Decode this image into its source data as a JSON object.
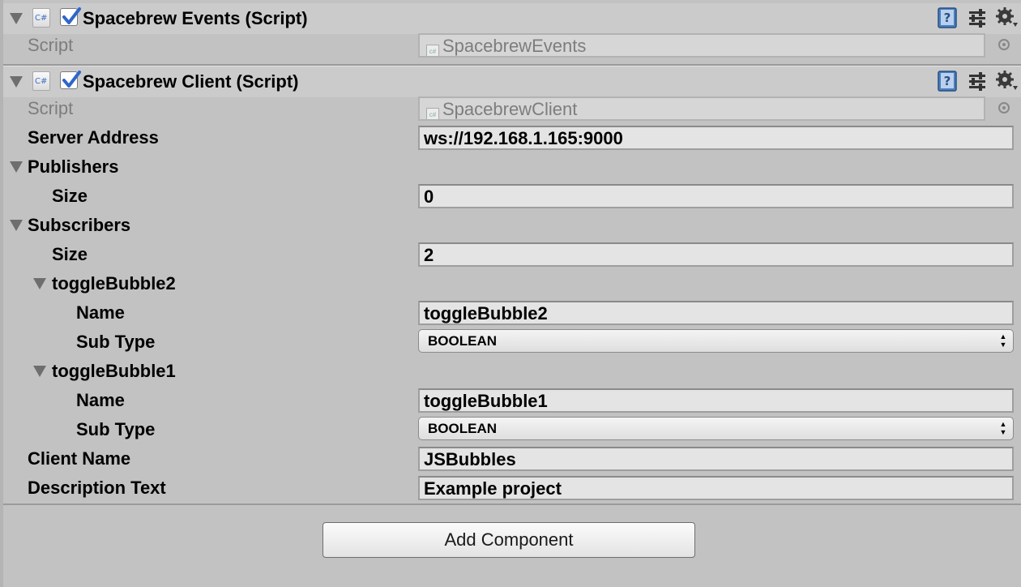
{
  "components": [
    {
      "title": "Spacebrew Events (Script)",
      "enabled": true,
      "icon": "csharp-script-icon",
      "script_label": "Script",
      "script_value": "SpacebrewEvents"
    },
    {
      "title": "Spacebrew Client (Script)",
      "enabled": true,
      "icon": "csharp-script-icon",
      "script_label": "Script",
      "script_value": "SpacebrewClient",
      "server_address": {
        "label": "Server Address",
        "value": "ws://192.168.1.165:9000"
      },
      "publishers": {
        "label": "Publishers",
        "size_label": "Size",
        "size": "0"
      },
      "subscribers": {
        "label": "Subscribers",
        "size_label": "Size",
        "size": "2",
        "items": [
          {
            "header": "toggleBubble2",
            "name_label": "Name",
            "name": "toggleBubble2",
            "type_label": "Sub Type",
            "type": "BOOLEAN"
          },
          {
            "header": "toggleBubble1",
            "name_label": "Name",
            "name": "toggleBubble1",
            "type_label": "Sub Type",
            "type": "BOOLEAN"
          }
        ]
      },
      "client_name": {
        "label": "Client Name",
        "value": "JSBubbles"
      },
      "description": {
        "label": "Description Text",
        "value": "Example project"
      }
    }
  ],
  "add_component_label": "Add Component",
  "mini_icon_text": "c#",
  "header_icon_text": "C#",
  "select_arrows": "▲▼",
  "colors": {
    "panel": "#c2c2c2",
    "header": "#cbcbcb",
    "field": "#e4e4e4",
    "checkmark": "#2f66c9"
  }
}
